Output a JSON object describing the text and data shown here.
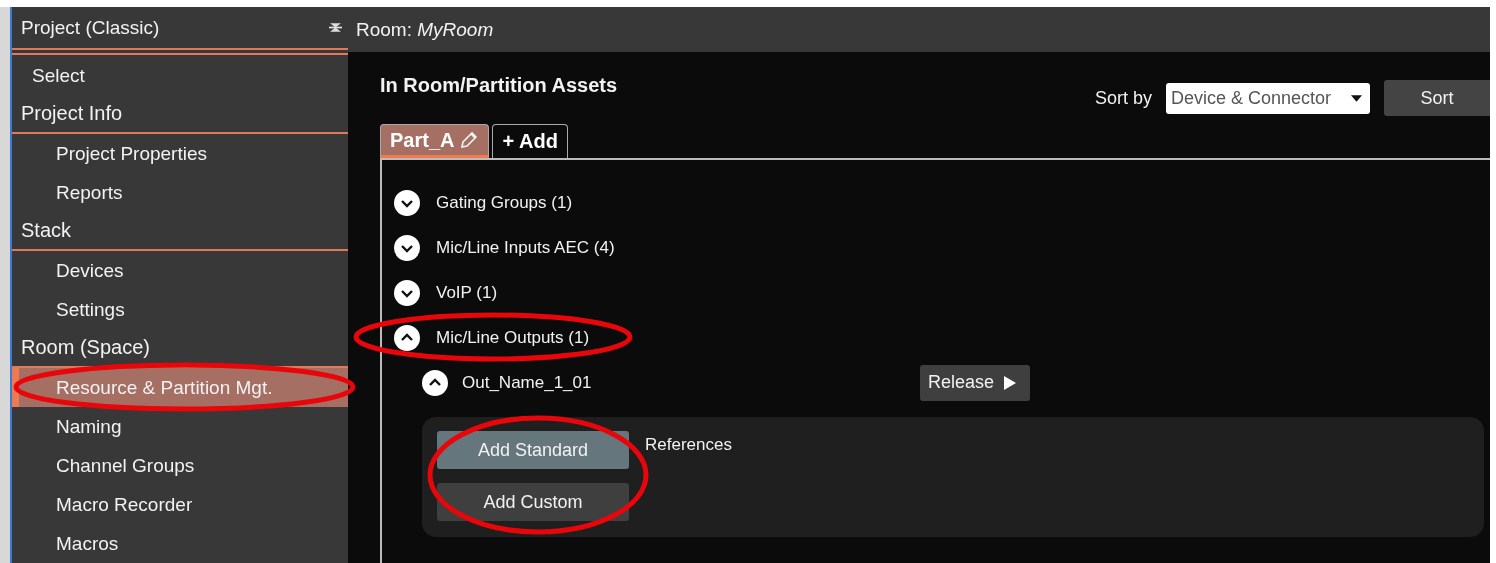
{
  "sidebar": {
    "title": "Project (Classic)",
    "items": [
      {
        "kind": "item",
        "label": "Select",
        "selected": false,
        "circled": false,
        "indent": false
      },
      {
        "kind": "section",
        "label": "Project Info",
        "selected": false,
        "circled": false,
        "indent": false
      },
      {
        "kind": "item",
        "label": "Project Properties",
        "selected": false,
        "circled": false,
        "indent": true
      },
      {
        "kind": "item",
        "label": "Reports",
        "selected": false,
        "circled": false,
        "indent": true
      },
      {
        "kind": "section",
        "label": "Stack",
        "selected": false,
        "circled": false,
        "indent": false
      },
      {
        "kind": "item",
        "label": "Devices",
        "selected": false,
        "circled": false,
        "indent": true
      },
      {
        "kind": "item",
        "label": "Settings",
        "selected": false,
        "circled": false,
        "indent": true
      },
      {
        "kind": "section",
        "label": "Room (Space)",
        "selected": false,
        "circled": false,
        "indent": false
      },
      {
        "kind": "item",
        "label": "Resource & Partition Mgt.",
        "selected": true,
        "circled": true,
        "indent": true
      },
      {
        "kind": "item",
        "label": "Naming",
        "selected": false,
        "circled": false,
        "indent": true
      },
      {
        "kind": "item",
        "label": "Channel Groups",
        "selected": false,
        "circled": false,
        "indent": true
      },
      {
        "kind": "item",
        "label": "Macro Recorder",
        "selected": false,
        "circled": false,
        "indent": true
      },
      {
        "kind": "item",
        "label": "Macros",
        "selected": false,
        "circled": false,
        "indent": true
      }
    ]
  },
  "header": {
    "label": "Room:",
    "value": "MyRoom"
  },
  "heading": "In Room/Partition Assets",
  "sort": {
    "label": "Sort by",
    "value": "Device & Connector",
    "button": "Sort"
  },
  "tabs": [
    {
      "label": "Part_A",
      "selected": true,
      "kind": "partition"
    },
    {
      "label": "+ Add",
      "selected": false,
      "kind": "add"
    }
  ],
  "groups": [
    {
      "label": "Gating Groups (1)",
      "expanded": false,
      "circled": false
    },
    {
      "label": "Mic/Line Inputs AEC (4)",
      "expanded": false,
      "circled": false
    },
    {
      "label": "VoIP (1)",
      "expanded": false,
      "circled": false
    },
    {
      "label": "Mic/Line Outputs (1)",
      "expanded": true,
      "circled": true,
      "children": [
        {
          "label": "Out_Name_1_01",
          "expanded": true,
          "action": "Release",
          "references": {
            "label": "References",
            "circled": true,
            "buttons": [
              {
                "label": "Add Standard",
                "kind": "standard"
              },
              {
                "label": "Add Custom",
                "kind": "custom"
              }
            ]
          }
        }
      ]
    }
  ]
}
